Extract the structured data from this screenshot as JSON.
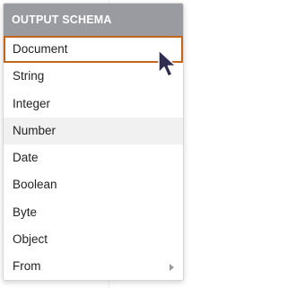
{
  "menu": {
    "header": "OUTPUT SCHEMA",
    "items": [
      {
        "label": "Document"
      },
      {
        "label": "String"
      },
      {
        "label": "Integer"
      },
      {
        "label": "Number"
      },
      {
        "label": "Date"
      },
      {
        "label": "Boolean"
      },
      {
        "label": "Byte"
      },
      {
        "label": "Object"
      },
      {
        "label": "From"
      }
    ]
  },
  "icons": {
    "submenu": "chevron-right-icon",
    "cursor": "mouse-pointer-icon"
  },
  "colors": {
    "header_bg": "#9a9aa1",
    "focus_border": "#c4651a",
    "hover_bg": "#f1f1f2",
    "cursor": "#2f2e52"
  }
}
